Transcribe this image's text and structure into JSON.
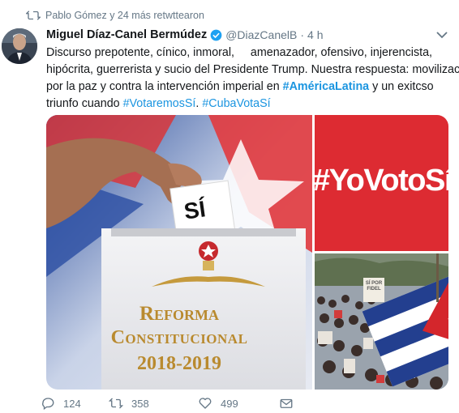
{
  "retweet_line": {
    "text": "Pablo Gómez y 24 más retwttearon",
    "icon": "retweet-icon"
  },
  "tweet": {
    "author_name": "Miguel Díaz-Canel Bermúdez",
    "verified_icon": "verified-badge-icon",
    "handle": "@DiazCanelB",
    "separator": "·",
    "time": "4 h",
    "text_line1": "Discurso prepotente, cínico, inmoral,     amenazador, ofensivo, injerencista,",
    "text_line2": "hipócrita, guerrerista y sucio del Presidente Trump. Nuestra respuesta: movilización",
    "text_line3a": "por la paz y contra la intervención imperial en ",
    "hashtag_america": "#AméricaLatina",
    "text_line3b": " y un exitcso",
    "text_line4a": "triunfo cuando ",
    "hashtag_votaremos": "#VotaremosSí",
    "text_line4b": ". ",
    "hashtag_cuba": "#CubaVotaSí"
  },
  "media": {
    "image1": {
      "slip_text": "SÍ",
      "title_line1": "Reforma",
      "title_line2": "Constitucional",
      "title_line3": "2018-2019"
    },
    "image2": {
      "text": "#YoVotoSí"
    },
    "image3": {
      "sign_text": "SÍ POR FIDEL"
    }
  },
  "actions": {
    "reply_count": "124",
    "retweet_count": "358",
    "like_count": "499"
  },
  "colors": {
    "link": "#1b95e0",
    "muted": "#657786",
    "red": "#dd2b32"
  }
}
